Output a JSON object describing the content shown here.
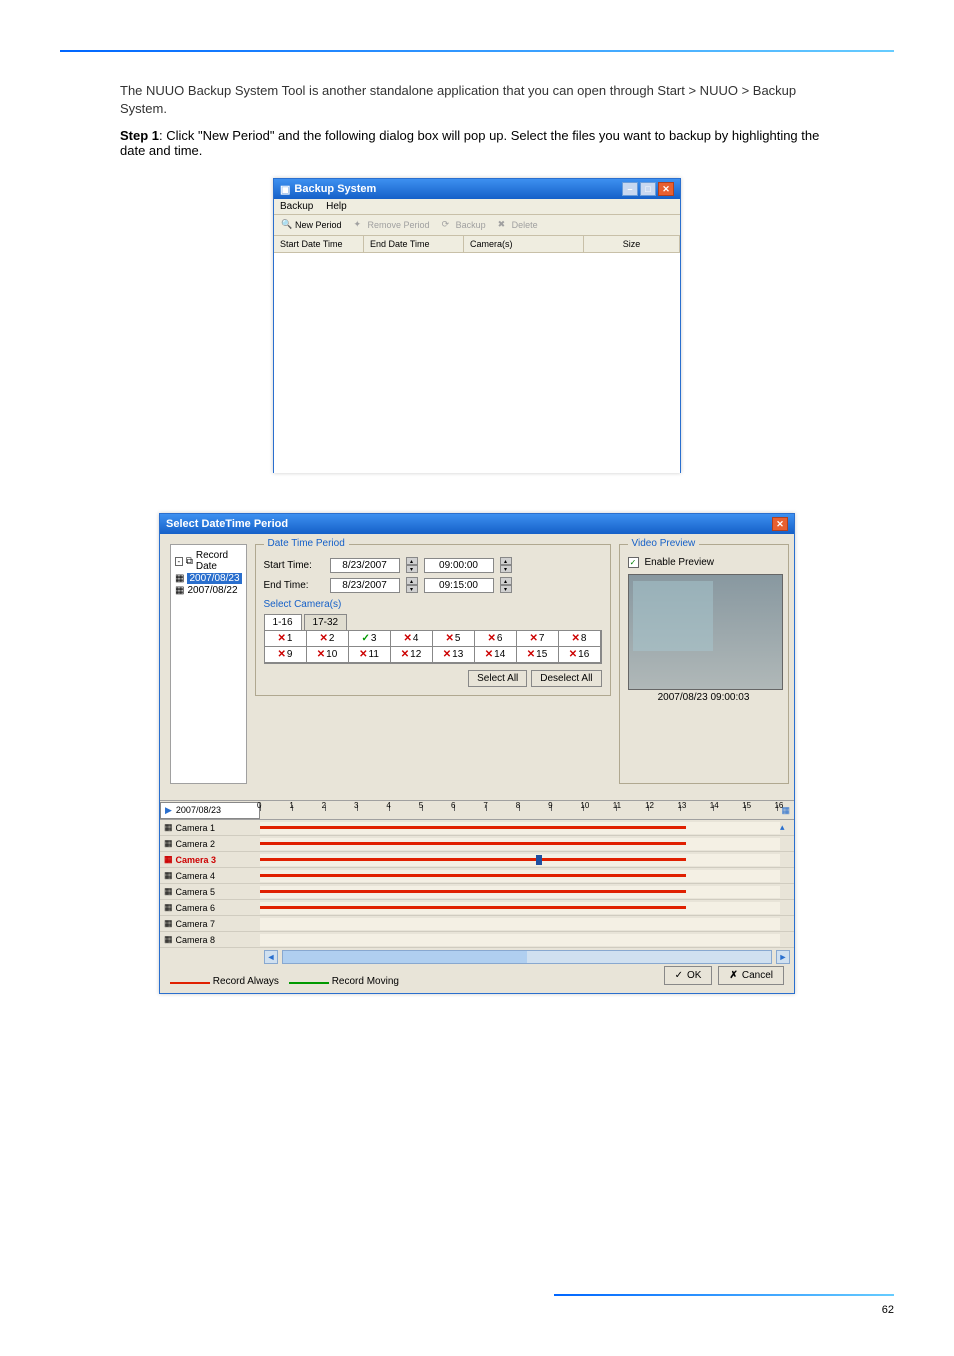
{
  "doc": {
    "intro": "The NUUO Backup System Tool is another standalone application that you can open through Start > NUUO > Backup System.",
    "step1_label": "Step 1",
    "step1_text": ": Click \"New Period\" and the following dialog box will pop up. Select the files you want to backup by highlighting the date and time.",
    "page_number": "62"
  },
  "win1": {
    "title": "Backup System",
    "menu": {
      "backup": "Backup",
      "help": "Help"
    },
    "toolbar": {
      "new_period": "New Period",
      "remove_period": "Remove Period",
      "backup": "Backup",
      "delete": "Delete"
    },
    "cols": {
      "start": "Start Date Time",
      "end": "End Date Time",
      "cam": "Camera(s)",
      "size": "Size"
    }
  },
  "win2": {
    "title": "Select DateTime Period",
    "tree": {
      "root": "Record Date",
      "d1": "2007/08/23",
      "d2": "2007/08/22"
    },
    "dtp": {
      "group": "Date Time Period",
      "start_lbl": "Start Time:",
      "end_lbl": "End Time:",
      "start_date": "8/23/2007",
      "start_time": "09:00:00",
      "end_date": "8/23/2007",
      "end_time": "09:15:00"
    },
    "cams": {
      "title": "Select Camera(s)",
      "tab1": "1-16",
      "tab2": "17-32",
      "cells": [
        "1",
        "2",
        "3",
        "4",
        "5",
        "6",
        "7",
        "8",
        "9",
        "10",
        "11",
        "12",
        "13",
        "14",
        "15",
        "16"
      ],
      "select_all": "Select All",
      "deselect_all": "Deselect All"
    },
    "preview": {
      "group": "Video Preview",
      "enable": "Enable Preview",
      "timestamp": "2007/08/23 09:00:03"
    },
    "timeline": {
      "date": "2007/08/23",
      "hours": [
        "0",
        "1",
        "2",
        "3",
        "4",
        "5",
        "6",
        "7",
        "8",
        "9",
        "10",
        "11",
        "12",
        "13",
        "14",
        "15",
        "16"
      ],
      "rows": [
        "Camera 1",
        "Camera 2",
        "Camera 3",
        "Camera 4",
        "Camera 5",
        "Camera 6",
        "Camera 7",
        "Camera 8"
      ],
      "legend_always": "Record Always",
      "legend_moving": "Record Moving"
    },
    "footer": {
      "ok": "OK",
      "cancel": "Cancel"
    }
  }
}
